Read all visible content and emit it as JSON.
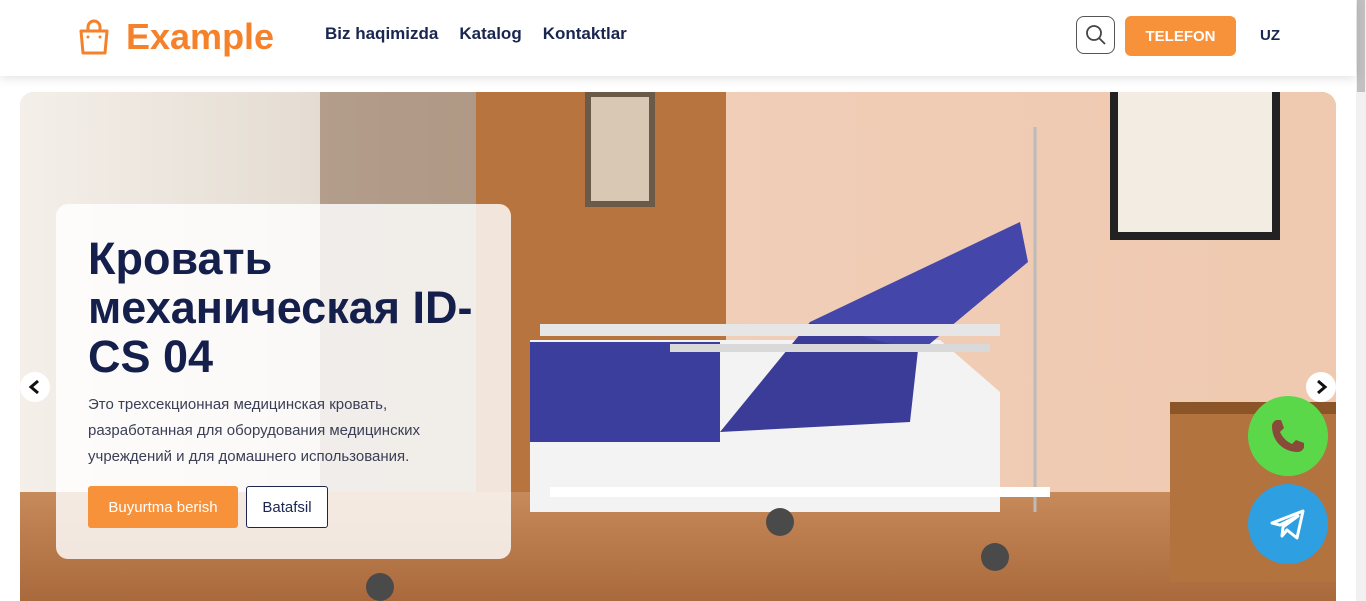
{
  "header": {
    "logo_text": "Example",
    "nav": [
      "Biz haqimizda",
      "Katalog",
      "Kontaktlar"
    ],
    "phone_label": "TELEFON",
    "lang": "UZ"
  },
  "hero": {
    "title": "Кровать механическая ID-CS 04",
    "description": "Это трехсекционная медицинская кровать, разработанная для оборудования медицинских учреждений и для домашнего использования.",
    "order_label": "Buyurtma berish",
    "more_label": "Batafsil"
  },
  "colors": {
    "accent": "#f7923a",
    "brand": "#f5822a",
    "navy": "#141f4b",
    "whatsapp": "#5bd84a",
    "telegram": "#2e9fe0"
  }
}
